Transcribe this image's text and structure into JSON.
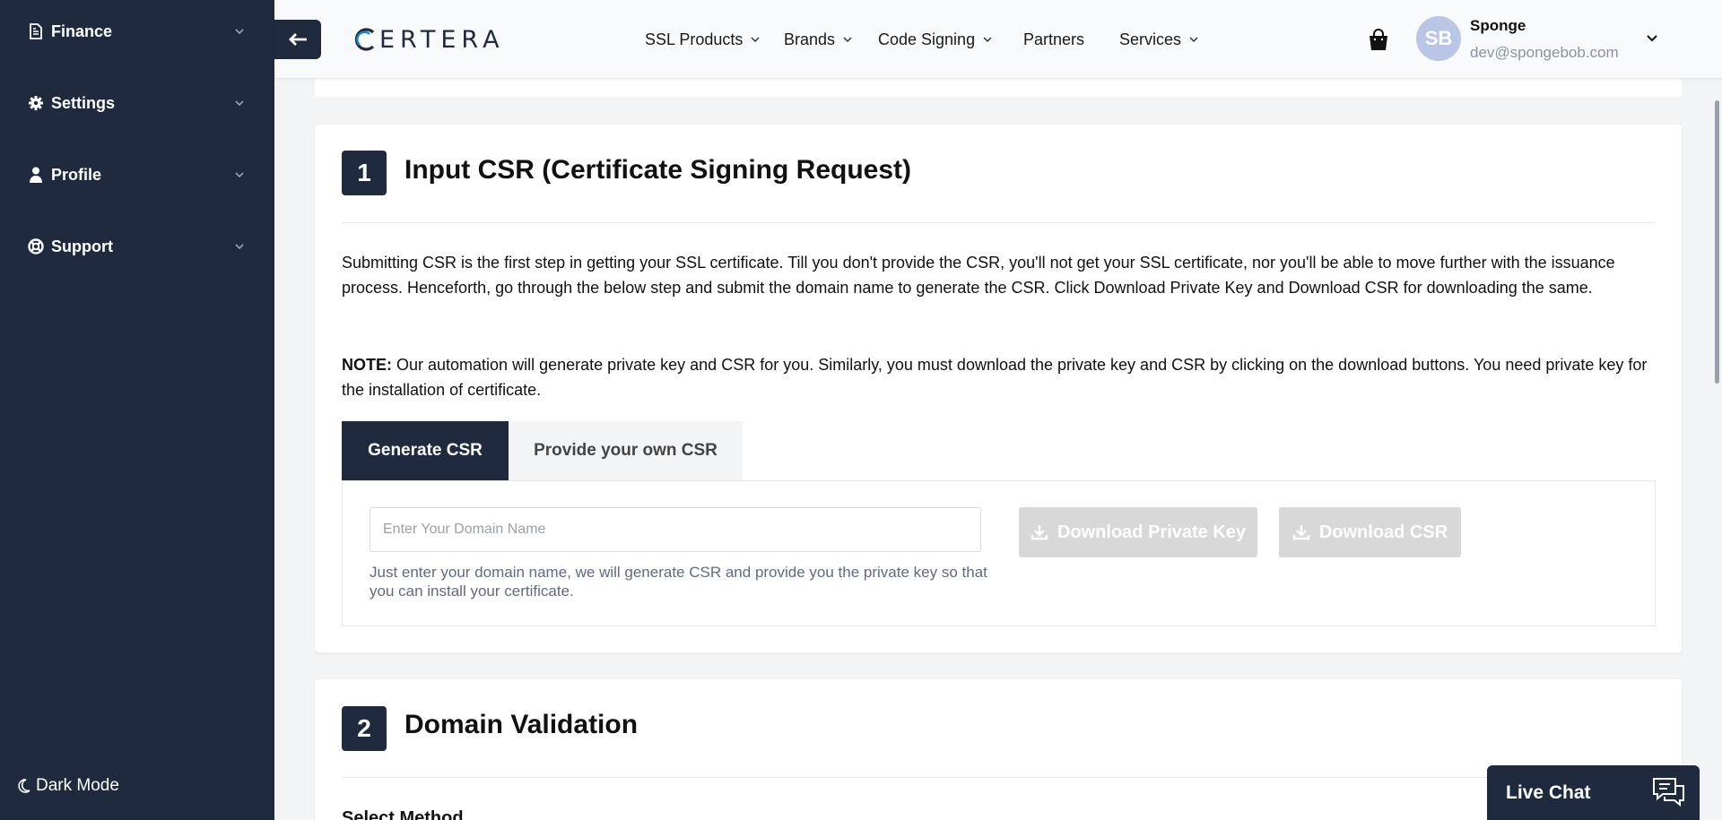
{
  "sidebar": {
    "items": [
      {
        "label": "Finance",
        "icon": "document-icon"
      },
      {
        "label": "Settings",
        "icon": "gear-icon"
      },
      {
        "label": "Profile",
        "icon": "user-icon"
      },
      {
        "label": "Support",
        "icon": "lifebuoy-icon"
      }
    ],
    "dark_mode_label": "Dark Mode"
  },
  "header": {
    "logo_text": "ERTERA",
    "nav": [
      {
        "label": "SSL Products",
        "has_dropdown": true
      },
      {
        "label": "Brands",
        "has_dropdown": true
      },
      {
        "label": "Code Signing",
        "has_dropdown": true
      },
      {
        "label": "Partners",
        "has_dropdown": false
      },
      {
        "label": "Services",
        "has_dropdown": true
      }
    ],
    "user": {
      "initials": "SB",
      "name": "Sponge",
      "email": "dev@spongebob.com"
    }
  },
  "step1": {
    "number": "1",
    "title": "Input CSR (Certificate Signing Request)",
    "description": "Submitting CSR is the first step in getting your SSL certificate. Till you don't provide the CSR, you'll not get your SSL certificate, nor you'll be able to move further with the issuance process. Henceforth, go through the below step and submit the domain name to generate the CSR. Click Download Private Key and Download CSR for downloading the same.",
    "note_label": "NOTE:",
    "note_text": " Our automation will generate private key and CSR for you. Similarly, you must download the private key and CSR by clicking on the download buttons. You need private key for the installation of certificate.",
    "tabs": [
      {
        "label": "Generate CSR",
        "active": true
      },
      {
        "label": "Provide your own CSR",
        "active": false
      }
    ],
    "domain_input": {
      "value": "",
      "placeholder": "Enter Your Domain Name"
    },
    "help_text": "Just enter your domain name, we will generate CSR and provide you the private key so that you can install your certificate.",
    "download_private_key_label": "Download Private Key",
    "download_csr_label": "Download CSR"
  },
  "step2": {
    "number": "2",
    "title": "Domain Validation",
    "select_method_label": "Select Method"
  },
  "live_chat": {
    "label": "Live Chat"
  },
  "colors": {
    "sidebar_bg": "#1f2a3f",
    "accent_dark": "#1f2a3f",
    "disabled_button": "#d8d8d8",
    "avatar_bg": "#b9c6e6",
    "logo_blue": "#1e88c7"
  }
}
